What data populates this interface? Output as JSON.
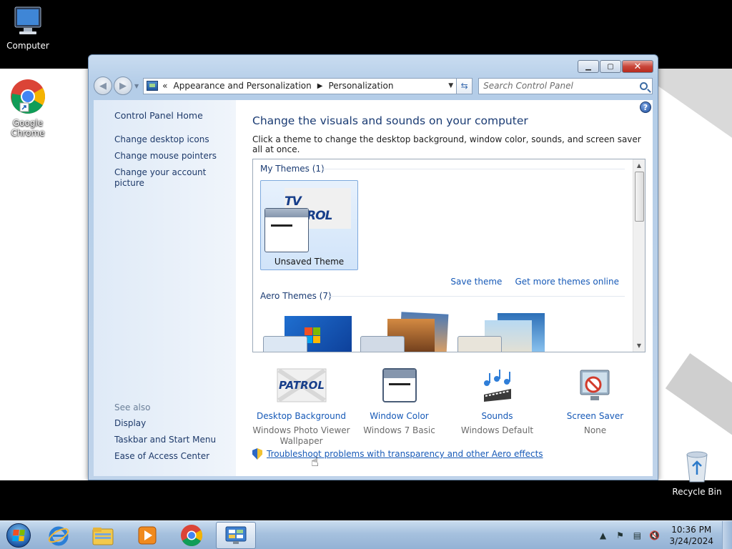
{
  "desktop": {
    "icons": [
      {
        "label": "Computer"
      },
      {
        "label": "Google\nChrome"
      },
      {
        "label": "Recycle Bin"
      }
    ]
  },
  "window": {
    "address": {
      "overflow": "«",
      "crumbs": [
        "Appearance and Personalization",
        "Personalization"
      ]
    },
    "search_placeholder": "Search Control Panel",
    "sidebar": {
      "home": "Control Panel Home",
      "links": [
        "Change desktop icons",
        "Change mouse pointers",
        "Change your account picture"
      ],
      "see_also_heading": "See also",
      "see_also": [
        "Display",
        "Taskbar and Start Menu",
        "Ease of Access Center"
      ]
    },
    "main": {
      "title": "Change the visuals and sounds on your computer",
      "description": "Click a theme to change the desktop background, window color, sounds, and screen saver all at once.",
      "my_themes_heading": "My Themes (1)",
      "selected_theme": "Unsaved Theme",
      "save_theme": "Save theme",
      "more_themes": "Get more themes online",
      "aero_themes_heading": "Aero Themes (7)",
      "thumbnail_logo": "TV PATROL"
    },
    "settings": [
      {
        "name": "Desktop Background",
        "value": "Windows Photo Viewer\nWallpaper",
        "icon": "desktop-background-icon"
      },
      {
        "name": "Window Color",
        "value": "Windows 7 Basic",
        "icon": "window-color-icon"
      },
      {
        "name": "Sounds",
        "value": "Windows Default",
        "icon": "sounds-icon"
      },
      {
        "name": "Screen Saver",
        "value": "None",
        "icon": "screen-saver-icon"
      }
    ],
    "troubleshoot_link": "Troubleshoot problems with transparency and other Aero effects"
  },
  "taskbar": {
    "time": "10:36 PM",
    "date": "3/24/2024"
  },
  "colors": {
    "link": "#1659b7",
    "heading": "#1a3b73",
    "taskbar": "#a6c1de"
  }
}
